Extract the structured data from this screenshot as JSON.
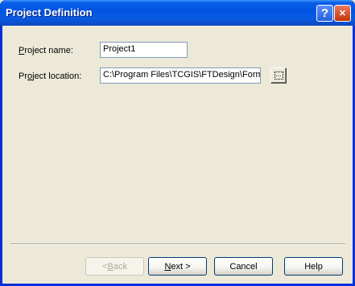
{
  "window": {
    "title": "Project Definition",
    "help_glyph": "?",
    "close_glyph": "✕",
    "icons": {
      "help": "help-icon",
      "close": "close-icon",
      "browse": "browse-folder-icon"
    }
  },
  "form": {
    "project_name": {
      "label_accel": "P",
      "label_rest": "roject name:",
      "value": "Project1"
    },
    "project_location": {
      "label_pre": "Pr",
      "label_accel": "o",
      "label_rest": "ject location:",
      "value": "C:\\Program Files\\TCGIS\\FTDesign\\Forms"
    },
    "browse_glyph": "..."
  },
  "buttons": {
    "back": {
      "pre": "< ",
      "accel": "B",
      "rest": "ack",
      "enabled": false
    },
    "next": {
      "accel": "N",
      "rest": "ext >"
    },
    "cancel": {
      "label": "Cancel"
    },
    "help": {
      "label": "Help"
    }
  }
}
